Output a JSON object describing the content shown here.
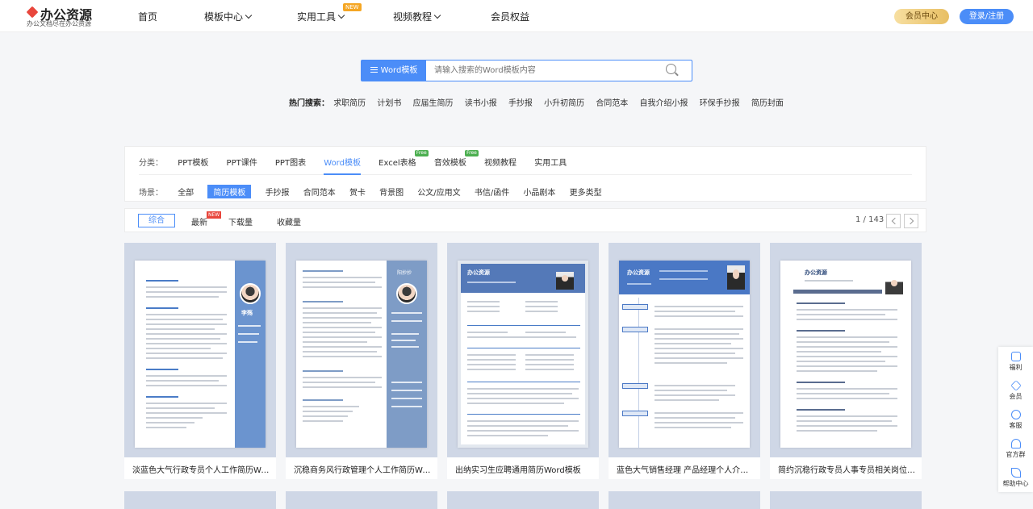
{
  "brand": {
    "name": "办公资源",
    "tagline": "办公文档尽在办公资源"
  },
  "nav": {
    "items": [
      {
        "label": "首页"
      },
      {
        "label": "模板中心"
      },
      {
        "label": "实用工具"
      },
      {
        "label": "视频教程"
      },
      {
        "label": "会员权益"
      }
    ],
    "new_badge": "NEW",
    "vip_label": "会员中心",
    "login_label": "登录/注册"
  },
  "search": {
    "type_label": "Word模板",
    "placeholder": "请输入搜索的Word模板内容"
  },
  "hot": {
    "label": "热门搜索：",
    "keywords": [
      "求职简历",
      "计划书",
      "应届生简历",
      "读书小报",
      "手抄报",
      "小升初简历",
      "合同范本",
      "自我介绍小报",
      "环保手抄报",
      "简历封面"
    ]
  },
  "filters": {
    "category_label": "分类：",
    "categories": [
      "PPT模板",
      "PPT课件",
      "PPT图表",
      "Word模板",
      "Excel表格",
      "音效模板",
      "视频教程",
      "实用工具"
    ],
    "free_badge": "Free",
    "scene_label": "场景：",
    "scenes": [
      "全部",
      "简历模板",
      "手抄报",
      "合同范本",
      "贺卡",
      "背景图",
      "公文/应用文",
      "书信/函件",
      "小品剧本",
      "更多类型"
    ]
  },
  "sort": {
    "options": [
      "综合",
      "最新",
      "下载量",
      "收藏量"
    ],
    "new_badge": "NEW",
    "page_info": "1 / 143"
  },
  "cards": [
    {
      "title": "淡蓝色大气行政专员个人工作简历Wor..."
    },
    {
      "title": "沉稳商务风行政管理个人工作简历Wor..."
    },
    {
      "title": "出纳实习生应聘通用简历Word模板"
    },
    {
      "title": "蓝色大气销售经理 产品经理个人介绍..."
    },
    {
      "title": "简约沉稳行政专员人事专员相关岗位个..."
    }
  ],
  "thumb_text": {
    "card1_name": "李殇",
    "card2_name": "阳抄抄",
    "card3_brand": "办公资源",
    "card4_brand": "办公资源",
    "card5_brand": "办公资源"
  },
  "sidebar": {
    "items": [
      {
        "label": "福利",
        "icon": "gift-icon"
      },
      {
        "label": "会员",
        "icon": "diamond-icon"
      },
      {
        "label": "客服",
        "icon": "headset-icon"
      },
      {
        "label": "官方群",
        "icon": "penguin-icon"
      },
      {
        "label": "帮助中心",
        "icon": "pen-icon"
      }
    ]
  },
  "colors": {
    "accent": "#4b8df8",
    "vip_gold": "#e8bf63",
    "badge_red": "#e8463c"
  }
}
